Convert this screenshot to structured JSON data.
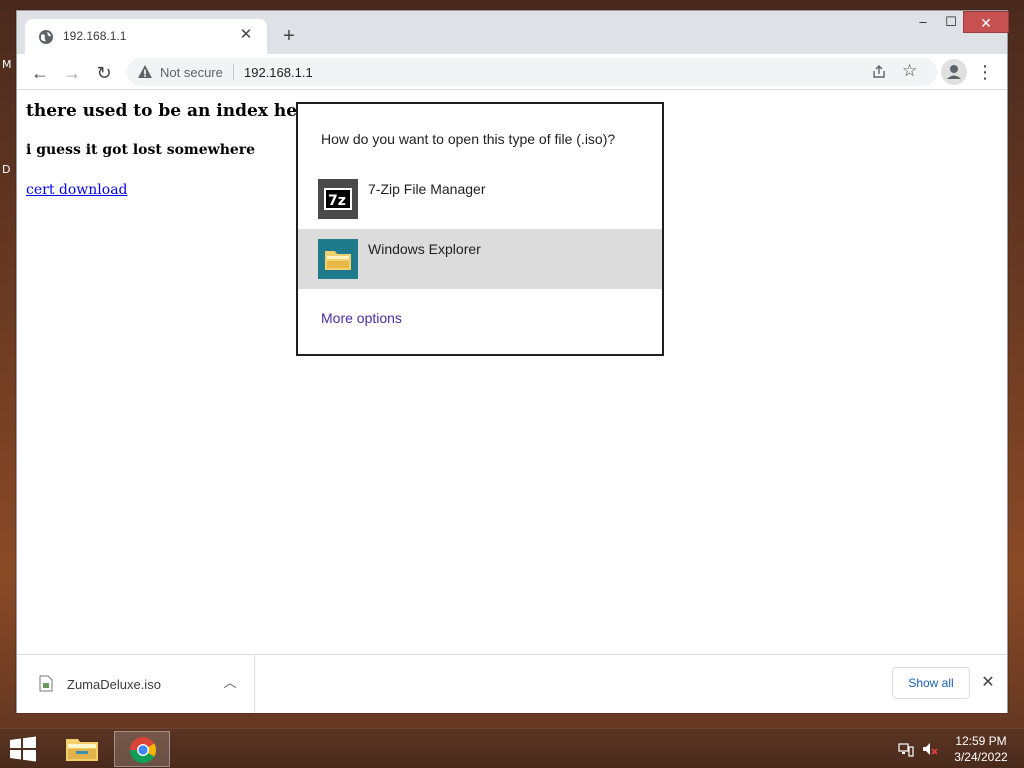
{
  "desktop": {
    "edge_text_1": "M",
    "edge_text_2": "D"
  },
  "browser": {
    "tab": {
      "title": "192.168.1.1",
      "close_glyph": "✕",
      "icon": "globe-icon"
    },
    "new_tab_glyph": "+",
    "window_controls": {
      "minimize": "–",
      "maximize": "☐",
      "close": "✕"
    },
    "nav": {
      "back": "←",
      "forward": "→",
      "reload": "↻"
    },
    "omnibox": {
      "security_label": "Not secure",
      "url": "192.168.1.1",
      "warning_icon": "warning-triangle-icon"
    },
    "star_glyph": "☆",
    "menu_glyph": "⋮"
  },
  "page": {
    "heading": "there used to be an index here",
    "subheading": "i guess it got lost somewhere",
    "link_text": "cert download"
  },
  "dialog": {
    "question": "How do you want to open this type of file (.iso)?",
    "apps": [
      {
        "label": "7-Zip File Manager",
        "icon": "7zip-icon"
      },
      {
        "label": "Windows Explorer",
        "icon": "folder-icon",
        "selected": true
      }
    ],
    "more_options": "More options"
  },
  "downloads": {
    "file_name": "ZumaDeluxe.iso",
    "chevron_glyph": "︿",
    "show_all_label": "Show all",
    "close_glyph": "✕"
  },
  "taskbar": {
    "time": "12:59 PM",
    "date": "3/24/2022"
  },
  "colors": {
    "selected_row": "#dcdcdc",
    "link": "#0000ee",
    "more_options": "#4a2ea0",
    "show_all": "#1a5fb4"
  }
}
